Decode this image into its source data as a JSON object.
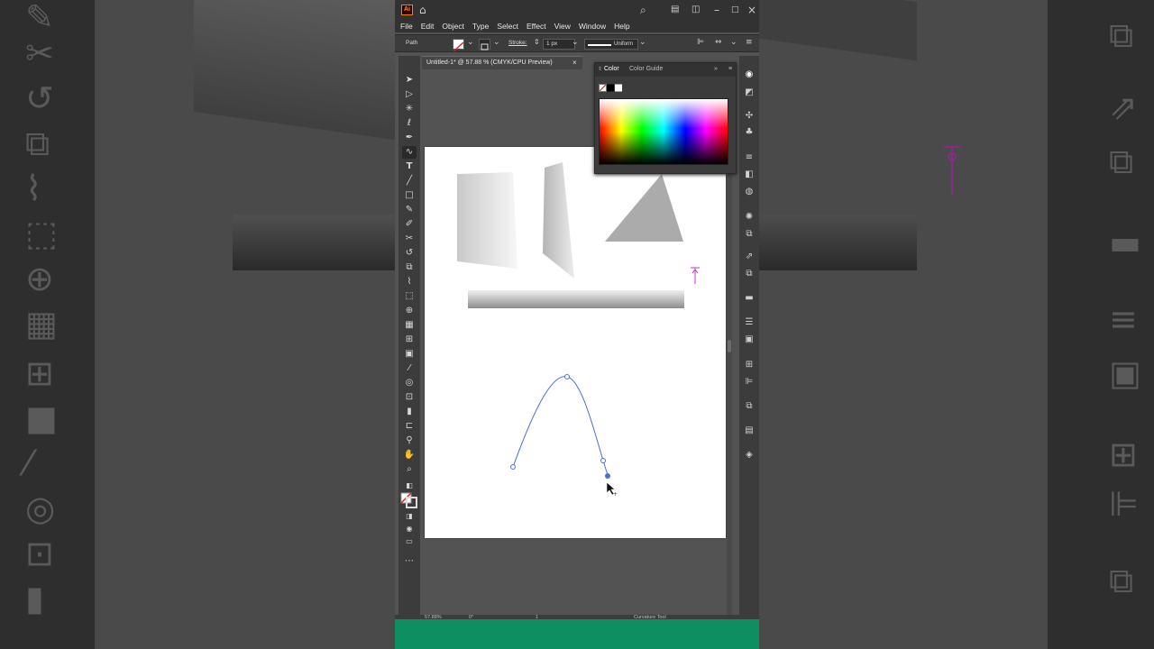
{
  "app": {
    "logo_text": "Ai",
    "menu": [
      "File",
      "Edit",
      "Object",
      "Type",
      "Select",
      "Effect",
      "View",
      "Window",
      "Help"
    ]
  },
  "control_bar": {
    "selection_type": "Path",
    "stroke_label": "Stroke:",
    "stroke_weight": "1 px",
    "profile": "Uniform"
  },
  "document": {
    "tab_title": "Untitled-1* @ 57.88 % (CMYK/CPU Preview)",
    "close_glyph": "×"
  },
  "color_panel": {
    "tabs": [
      "Color",
      "Color Guide"
    ],
    "active_tab": "Color"
  },
  "status_bar": {
    "zoom": "57.88%",
    "rotation": "0°",
    "artboard_number": "1",
    "current_tool": "Curvature Tool"
  },
  "colors": {
    "accent_anchor": "#4a6fd6",
    "brand_green": "#0d8f62",
    "ai_orange": "#ff9a00",
    "anchor_magenta": "#cc33cc"
  },
  "icons": {
    "tools": [
      "selection-tool-icon",
      "direct-selection-tool-icon",
      "magic-wand-icon",
      "lasso-icon",
      "pen-tool-icon",
      "curvature-tool-icon",
      "type-tool-icon",
      "line-tool-icon",
      "rectangle-tool-icon",
      "paintbrush-icon",
      "shaper-icon",
      "scissors-icon",
      "rotate-icon",
      "scale-icon",
      "warp-icon",
      "free-transform-icon",
      "shape-builder-icon",
      "perspective-grid-icon",
      "mesh-icon",
      "gradient-icon",
      "eyedropper-icon",
      "blend-icon",
      "symbol-sprayer-icon",
      "column-graph-icon",
      "artboard-icon",
      "slice-icon",
      "hand-icon",
      "zoom-icon"
    ]
  }
}
